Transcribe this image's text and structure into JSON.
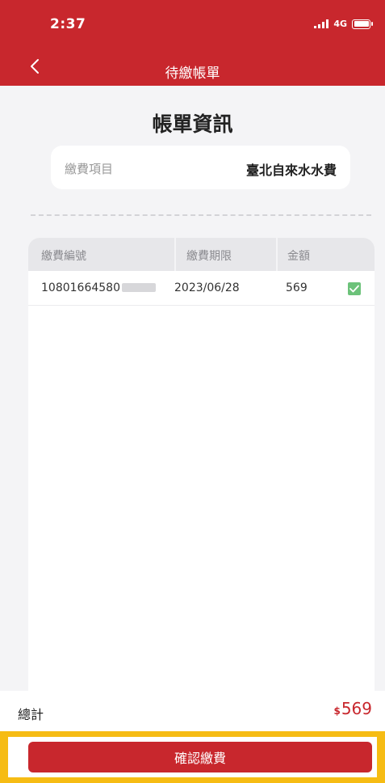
{
  "status_bar": {
    "time": "2:37",
    "network": "4G"
  },
  "header": {
    "title": "待繳帳單"
  },
  "page": {
    "title": "帳單資訊"
  },
  "item": {
    "label": "繳費項目",
    "value": "臺北自來水水費"
  },
  "table": {
    "headers": [
      "繳費編號",
      "繳費期限",
      "金額"
    ],
    "rows": [
      {
        "number": "10801664580",
        "deadline": "2023/06/28",
        "amount": "569",
        "checked": true
      }
    ]
  },
  "total": {
    "label": "總計",
    "currency": "$",
    "amount": "569"
  },
  "actions": {
    "confirm_label": "確認繳費"
  },
  "colors": {
    "brand_red": "#c8272d",
    "check_green": "#6cc27a",
    "highlight": "#f6bc14"
  }
}
